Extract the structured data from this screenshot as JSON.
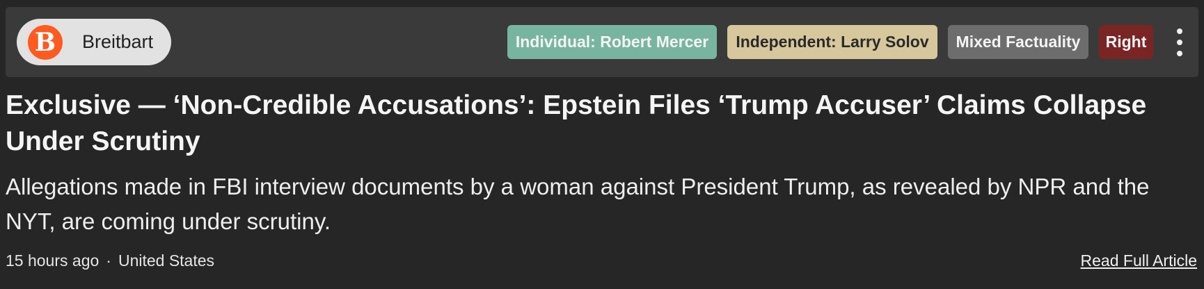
{
  "source": {
    "name": "Breitbart",
    "logo_letter": "B",
    "logo_color": "#ff5a1f"
  },
  "badges": {
    "owner": "Individual: Robert Mercer",
    "independent": "Independent: Larry Solov",
    "factuality": "Mixed Factuality",
    "bias": "Right"
  },
  "colors": {
    "owner": "#78b5a0",
    "independent": "#d7c79c",
    "factuality": "#6d6d6d",
    "bias": "#7b2424"
  },
  "icons": {
    "more": "more-vertical-icon"
  },
  "article": {
    "headline": "Exclusive — ‘Non-Credible Accusations’: Epstein Files ‘Trump Accuser’ Claims Collapse Under Scrutiny",
    "summary": "Allegations made in FBI interview documents by a woman against President Trump, as revealed by NPR and the NYT, are coming under scrutiny.",
    "time": "15 hours ago",
    "separator": "·",
    "location": "United States",
    "read_link": "Read Full Article"
  }
}
